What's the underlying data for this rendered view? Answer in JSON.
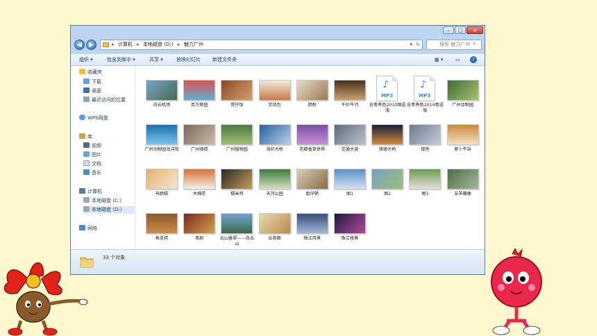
{
  "window": {
    "controls": {
      "minimize": "–",
      "maximize": "□",
      "close": "×"
    }
  },
  "address": {
    "back_icon": "◀",
    "forward_icon": "▶",
    "crumbs": [
      "计算机",
      "本地磁盘 (D:)",
      "魅力广州"
    ],
    "refresh": "↻",
    "search_placeholder": "搜索 魅力广州"
  },
  "toolbar": {
    "organize": "组织 ▾",
    "include_library": "包含到库中 ▾",
    "share": "共享 ▾",
    "slideshow": "放映幻灯片",
    "new_folder": "新建文件夹"
  },
  "nav": {
    "favorites": "收藏夹",
    "downloads": "下载",
    "desktop": "桌面",
    "recent": "最近访问的位置",
    "wps": "WPS网盘",
    "libraries": "库",
    "videos": "视频",
    "pictures": "图片",
    "documents": "文档",
    "music": "音乐",
    "computer": "计算机",
    "drive_c": "本地磁盘 (C:)",
    "drive_d": "本地磁盘 (D:)",
    "network": "网络"
  },
  "files": [
    {
      "label": "白云机场",
      "type": "image",
      "colors": [
        "#7ba1c6",
        "#3f6e54"
      ]
    },
    {
      "label": "百万葵园",
      "type": "image",
      "colors": [
        "#d9534f",
        "#5fb0cf"
      ]
    },
    {
      "label": "煲仔饭",
      "type": "image",
      "colors": [
        "#8b4a2a",
        "#d4a06a"
      ]
    },
    {
      "label": "叉烧包",
      "type": "image",
      "colors": [
        "#f4e9da",
        "#c47a4a"
      ]
    },
    {
      "label": "肠粉",
      "type": "image",
      "colors": [
        "#e8dcc6",
        "#9b7a55"
      ]
    },
    {
      "label": "干炒牛河",
      "type": "image",
      "colors": [
        "#4b2f1f",
        "#c9a36a"
      ]
    },
    {
      "label": "吉粤秀色2010国语版",
      "type": "mp3"
    },
    {
      "label": "吉粤秀色2014粤语版",
      "type": "mp3"
    },
    {
      "label": "广州动物园",
      "type": "image",
      "colors": [
        "#3c6b3a",
        "#a8c36c"
      ]
    },
    {
      "label": "广州动物园海洋馆",
      "type": "image",
      "colors": [
        "#1f6fb0",
        "#7cc4e8"
      ]
    },
    {
      "label": "广州骑楼",
      "type": "image",
      "colors": [
        "#7a6b5a",
        "#c9bba6"
      ]
    },
    {
      "label": "广州植物园",
      "type": "image",
      "colors": [
        "#4e7a3d",
        "#9cbf7a"
      ]
    },
    {
      "label": "海印大桥",
      "type": "image",
      "colors": [
        "#2b5f9e",
        "#b7cfe7"
      ]
    },
    {
      "label": "花都香草世界",
      "type": "image",
      "colors": [
        "#7b4ea1",
        "#c593d4"
      ]
    },
    {
      "label": "交通大道",
      "type": "image",
      "colors": [
        "#5d6b78",
        "#b9c3cc"
      ]
    },
    {
      "label": "猎德大桥",
      "type": "image",
      "colors": [
        "#1c1f3a",
        "#d08a3c"
      ]
    },
    {
      "label": "楼房",
      "type": "image",
      "colors": [
        "#6b7c8f",
        "#c2ccd6"
      ]
    },
    {
      "label": "萝卜牛杂",
      "type": "image",
      "colors": [
        "#c98a3c",
        "#f2e2c4"
      ]
    },
    {
      "label": "马蹄糕",
      "type": "image",
      "colors": [
        "#e5b26a",
        "#f6e6cf"
      ]
    },
    {
      "label": "木棉花",
      "type": "image",
      "colors": [
        "#d9723a",
        "#f3efe9"
      ]
    },
    {
      "label": "糯米鸡",
      "type": "image",
      "colors": [
        "#2a2a2a",
        "#c59a5a"
      ]
    },
    {
      "label": "天河公园",
      "type": "image",
      "colors": [
        "#3f7a3c",
        "#cfe2c0"
      ]
    },
    {
      "label": "艇仔粥",
      "type": "image",
      "colors": [
        "#d8cdb8",
        "#8a6a45"
      ]
    },
    {
      "label": "图1",
      "type": "image",
      "colors": [
        "#5b8fc9",
        "#d4e3f2"
      ]
    },
    {
      "label": "图2",
      "type": "image",
      "colors": [
        "#7aa0c0",
        "#9cbf7a"
      ]
    },
    {
      "label": "图3",
      "type": "image",
      "colors": [
        "#6d9a55",
        "#e6e1d8"
      ]
    },
    {
      "label": "五羊雕像",
      "type": "image",
      "colors": [
        "#4f6b45",
        "#a6b89a"
      ]
    },
    {
      "label": "鱼皮捞",
      "type": "image",
      "colors": [
        "#8a5a2a",
        "#cf8c4a"
      ]
    },
    {
      "label": "粤剧",
      "type": "image",
      "colors": [
        "#7a2a1e",
        "#d4a04a"
      ]
    },
    {
      "label": "云山叠翠——白云山",
      "type": "image",
      "colors": [
        "#6fa3d0",
        "#3d6b4a"
      ]
    },
    {
      "label": "云吞面",
      "type": "image",
      "colors": [
        "#e8d9b0",
        "#b98a4a"
      ]
    },
    {
      "label": "珠江风景",
      "type": "image",
      "colors": [
        "#3b4f7a",
        "#9fb6d8"
      ]
    },
    {
      "label": "珠江夜景",
      "type": "image",
      "colors": [
        "#1b1a3c",
        "#b24aa0"
      ]
    }
  ],
  "status": {
    "count_text": "33 个对象"
  }
}
